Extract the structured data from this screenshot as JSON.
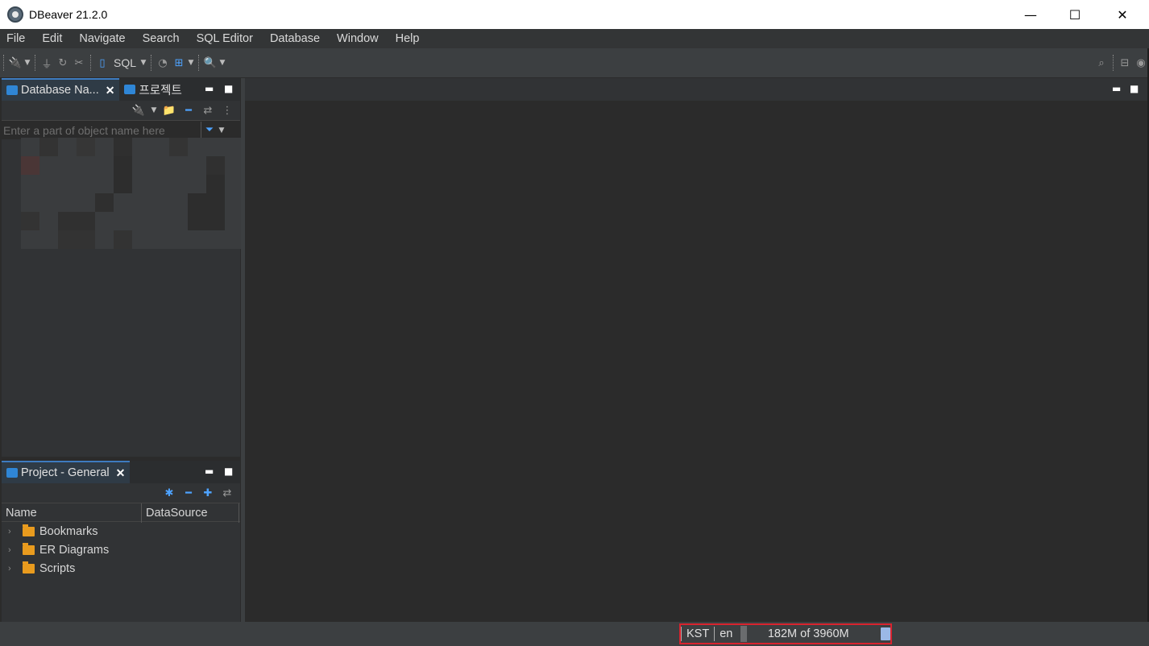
{
  "window": {
    "title": "DBeaver 21.2.0",
    "minimize": "—",
    "maximize": "☐",
    "close": "✕"
  },
  "menu": [
    "File",
    "Edit",
    "Navigate",
    "Search",
    "SQL Editor",
    "Database",
    "Window",
    "Help"
  ],
  "toolbar": {
    "sql_label": "SQL"
  },
  "navigator": {
    "tab_db": "Database Na...",
    "tab_projects": "프로젝트",
    "filter_placeholder": "Enter a part of object name here"
  },
  "project_panel": {
    "tab_label": "Project - General",
    "columns": [
      "Name",
      "DataSource"
    ],
    "items": [
      "Bookmarks",
      "ER Diagrams",
      "Scripts"
    ]
  },
  "status": {
    "timezone": "KST",
    "locale": "en",
    "memory": "182M of 3960M",
    "memory_used_fraction": 0.046
  },
  "colors": {
    "accent": "#2f86d6",
    "folder": "#e99b1e",
    "highlight_border": "#d9232e"
  }
}
